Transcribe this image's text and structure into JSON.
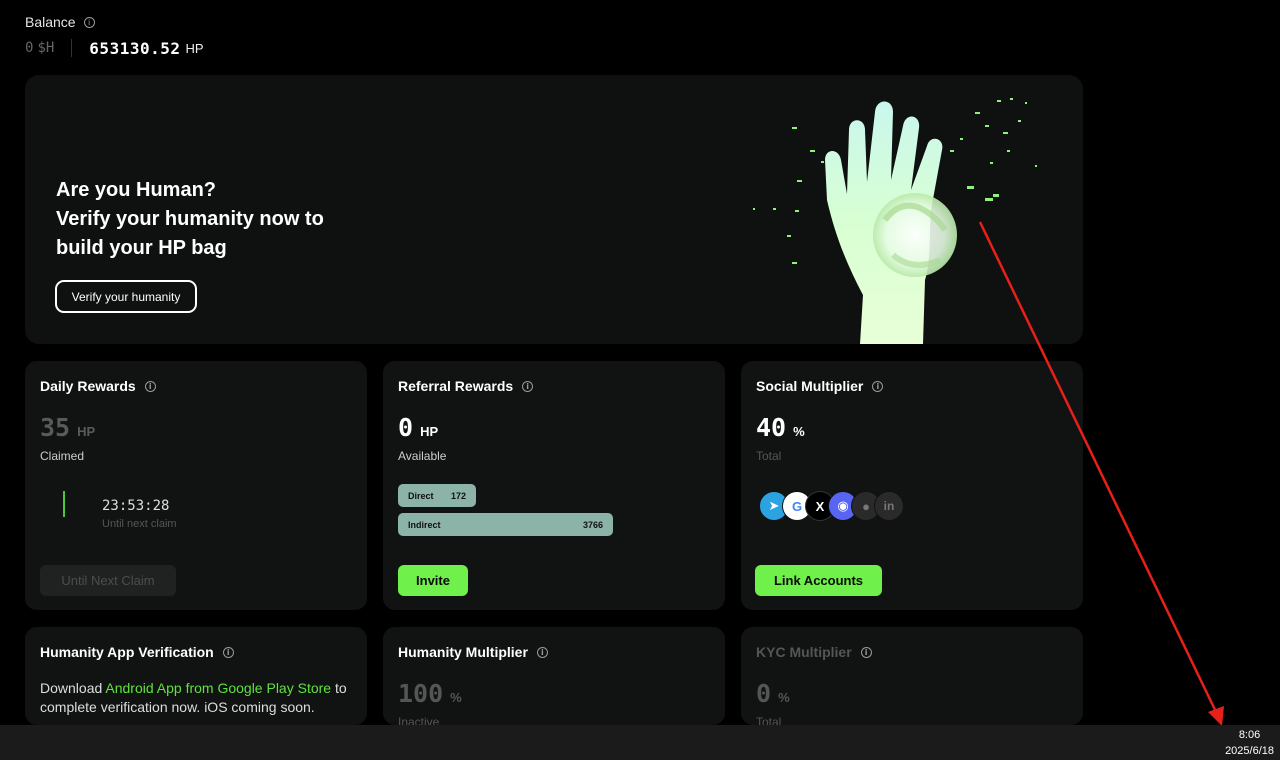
{
  "balance": {
    "label": "Balance",
    "sh_value": "0",
    "sh_unit": "$H",
    "hp_value": "653130.52",
    "hp_unit": "HP"
  },
  "hero": {
    "line1": "Are you Human?",
    "line2": "Verify your humanity now to",
    "line3": "build your HP bag",
    "button": "Verify your humanity"
  },
  "daily": {
    "title": "Daily Rewards",
    "value": "35",
    "unit": "HP",
    "status": "Claimed",
    "timer": "23:53:28",
    "timer_sub": "Until next claim",
    "button": "Until Next Claim"
  },
  "referral": {
    "title": "Referral Rewards",
    "value": "0",
    "unit": "HP",
    "status": "Available",
    "direct_label": "Direct",
    "direct_value": "172",
    "indirect_label": "Indirect",
    "indirect_value": "3766",
    "button": "Invite"
  },
  "social": {
    "title": "Social Multiplier",
    "value": "40",
    "unit": "%",
    "status": "Total",
    "icons": [
      "telegram-icon",
      "google-icon",
      "x-icon",
      "discord-icon",
      "github-icon",
      "linkedin-icon"
    ],
    "button": "Link Accounts"
  },
  "app": {
    "title": "Humanity App Verification",
    "text_pre": "Download ",
    "link": "Android App from Google Play Store",
    "text_post": "to complete verification now. iOS coming soon."
  },
  "humanity": {
    "title": "Humanity Multiplier",
    "value": "100",
    "unit": "%",
    "status": "Inactive"
  },
  "kyc": {
    "title": "KYC Multiplier",
    "value": "0",
    "unit": "%",
    "status": "Total"
  },
  "taskbar": {
    "time": "8:06",
    "date": "2025/6/18"
  },
  "colors": {
    "accent_green": "#6ff04a",
    "bar_teal": "#8cb3a8",
    "annotation_red": "#e8201a"
  }
}
